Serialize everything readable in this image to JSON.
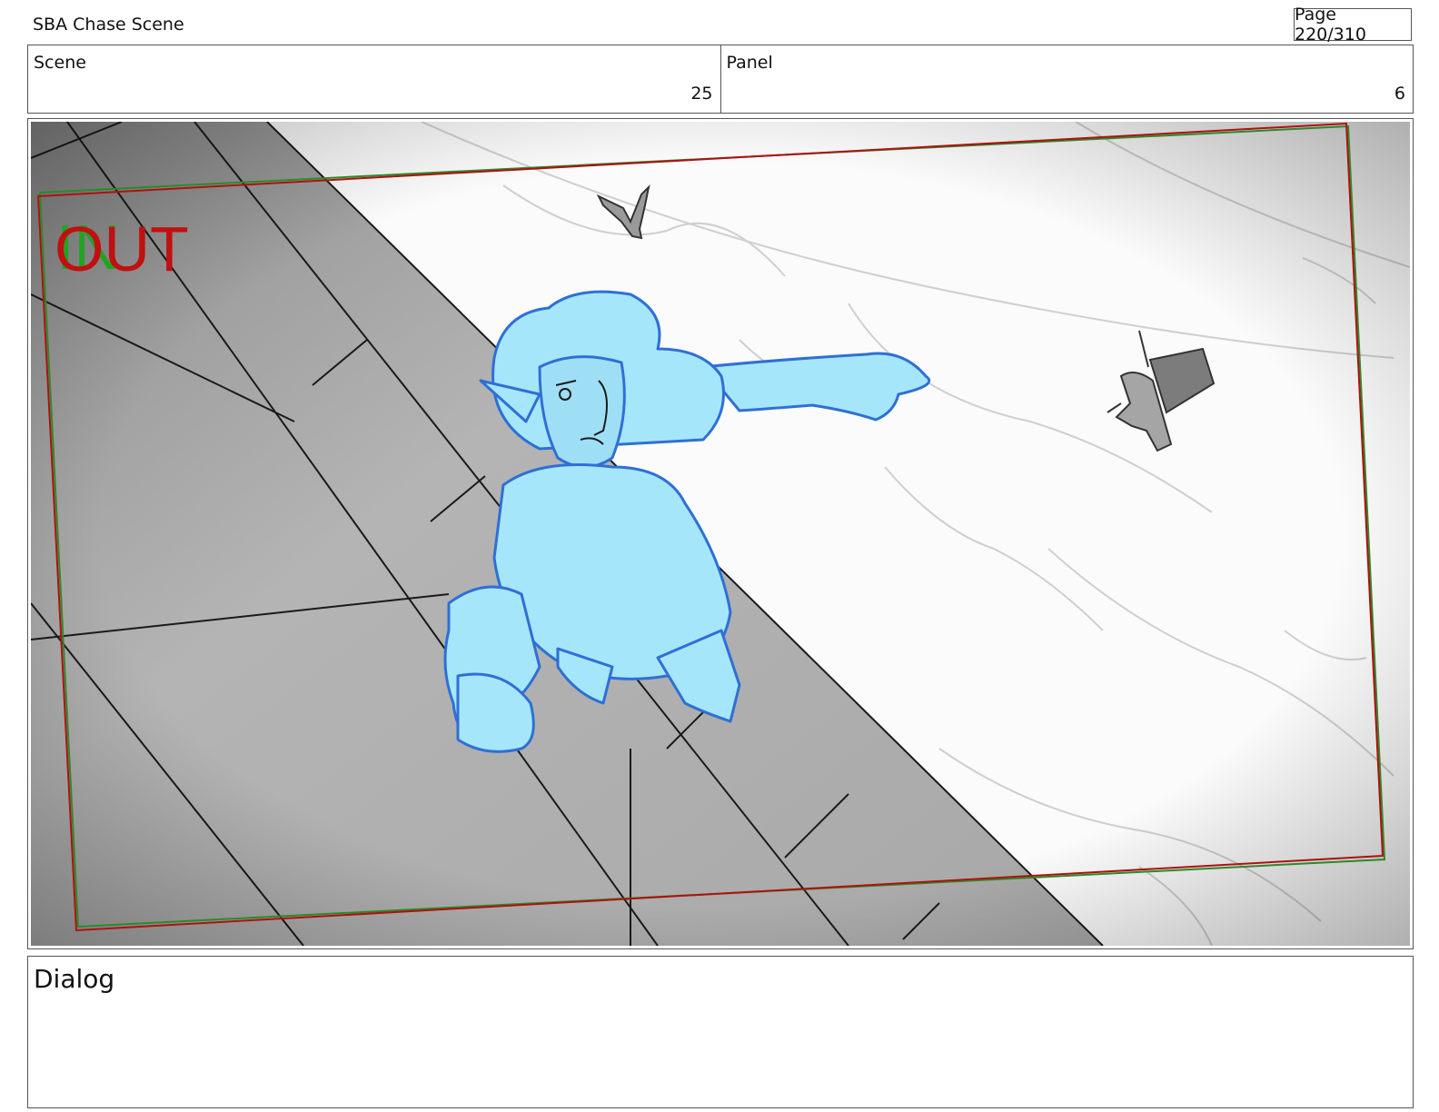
{
  "header": {
    "title": "SBA Chase Scene",
    "page": "Page 220/310"
  },
  "info": {
    "scene_label": "Scene",
    "scene_value": "25",
    "panel_label": "Panel",
    "panel_value": "6"
  },
  "panel": {
    "in_marker": "IN",
    "out_marker": "OUT",
    "colors": {
      "in": "#22a322",
      "out": "#c01010",
      "character_fill": "#a6e6fb",
      "character_line": "#2f6fd6"
    }
  },
  "dialog": {
    "label": "Dialog"
  }
}
